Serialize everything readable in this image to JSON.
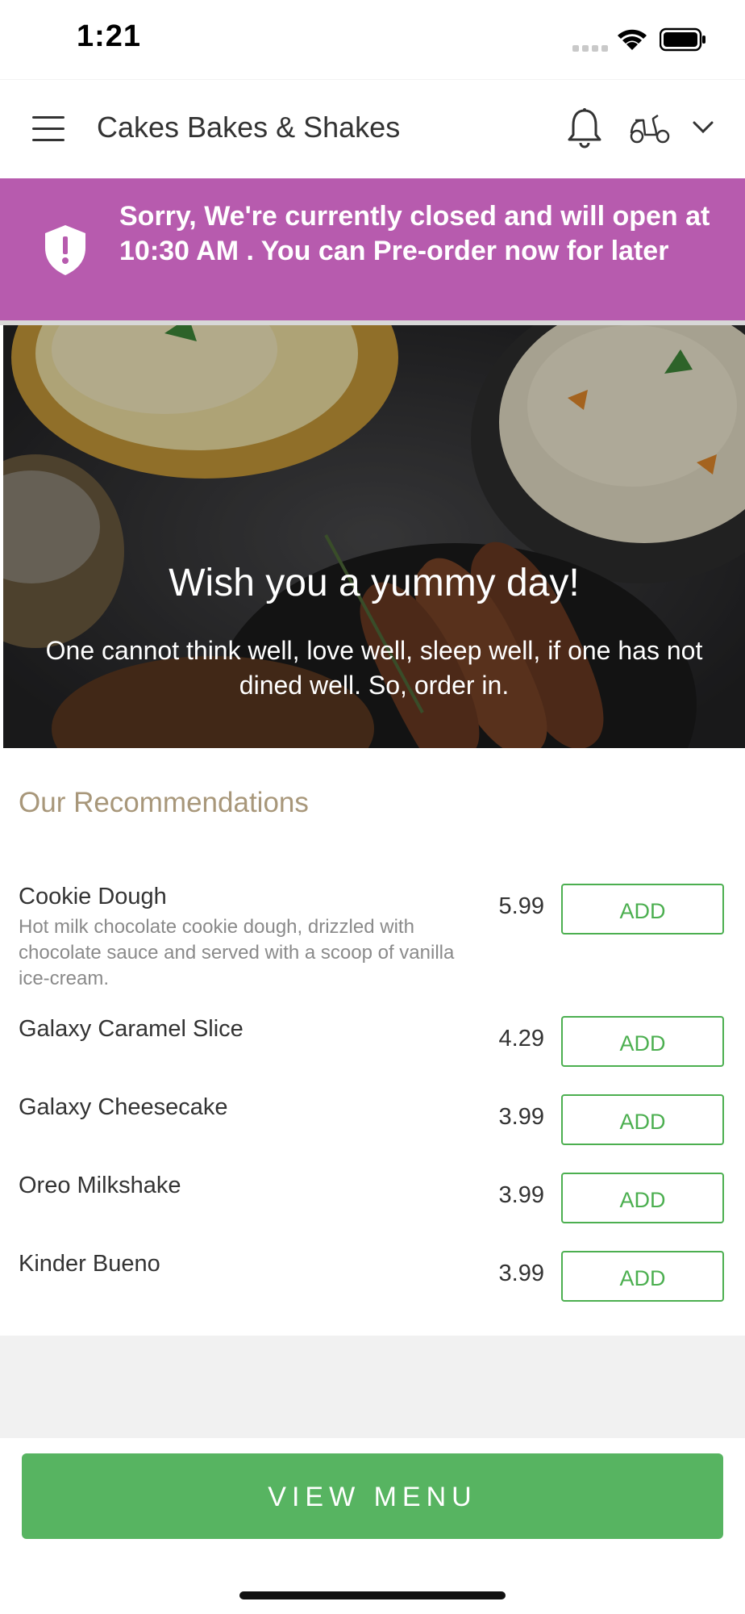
{
  "status_bar": {
    "time": "1:21"
  },
  "header": {
    "store_name": "Cakes Bakes & Shakes"
  },
  "banner": {
    "message": "Sorry, We're currently closed and will open at 10:30 AM . You can Pre-order now for later",
    "color": "#b75bae"
  },
  "hero": {
    "title": "Wish you a yummy day!",
    "quote": "One cannot think well, love well, sleep well, if one has not dined well. So, order in."
  },
  "recommendations": {
    "title": "Our Recommendations",
    "add_label": "ADD",
    "items": [
      {
        "name": "Cookie Dough",
        "description": "Hot milk chocolate cookie dough, drizzled with chocolate sauce and served with a scoop of vanilla ice-cream.",
        "price": "5.99"
      },
      {
        "name": "Galaxy Caramel Slice",
        "description": "",
        "price": "4.29"
      },
      {
        "name": "Galaxy Cheesecake",
        "description": "",
        "price": "3.99"
      },
      {
        "name": "Oreo Milkshake",
        "description": "",
        "price": "3.99"
      },
      {
        "name": "Kinder Bueno",
        "description": "",
        "price": "3.99"
      }
    ]
  },
  "footer": {
    "view_menu_label": "VIEW MENU",
    "accent_color": "#57b461"
  },
  "icons": [
    "menu-icon",
    "bell-icon",
    "scooter-icon",
    "chevron-down-icon",
    "shield-alert-icon",
    "wifi-icon",
    "battery-icon",
    "signal-icon"
  ]
}
